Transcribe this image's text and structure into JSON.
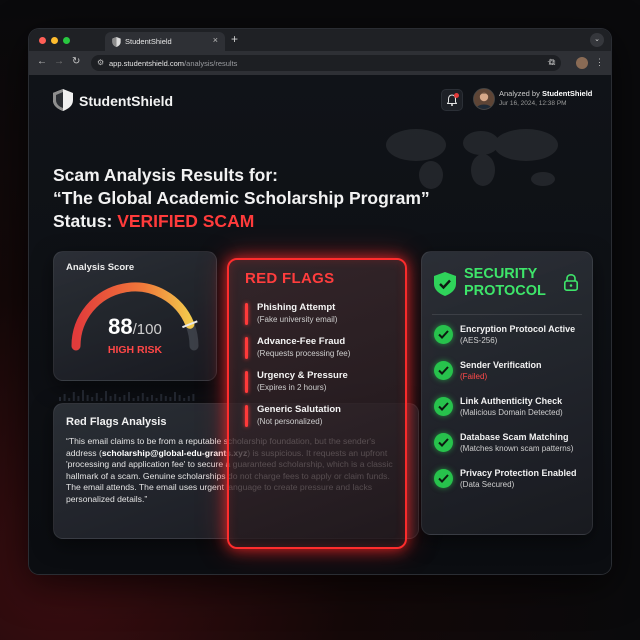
{
  "browser": {
    "tab_title": "StudentShield",
    "tab_close": "×",
    "new_tab": "+",
    "url_host": "app.studentshield.com",
    "url_path": "/analysis/results"
  },
  "header": {
    "brand": "StudentShield",
    "analyzed_prefix": "Analyzed by ",
    "analyzed_by": "StudentShield",
    "timestamp": "Jur 16, 2024, 12:38 PM"
  },
  "title": {
    "line1": "Scam Analysis Results for:",
    "line2": "“The Global Academic Scholarship Program”",
    "status_label": "Status: ",
    "status_value": "VERIFIED SCAM"
  },
  "score": {
    "title": "Analysis Score",
    "value": "88",
    "max": "/100",
    "value_fraction": 0.88,
    "risk": "HIGH RISK"
  },
  "red_flags": {
    "title": "RED FLAGS",
    "items": [
      {
        "name": "Phishing Attempt",
        "detail": "(Fake university email)"
      },
      {
        "name": "Advance-Fee Fraud",
        "detail": "(Requests processing fee)"
      },
      {
        "name": "Urgency & Pressure",
        "detail": "(Expires in 2 hours)"
      },
      {
        "name": "Generic Salutation",
        "detail": "(Not personalized)"
      }
    ]
  },
  "analysis": {
    "title": "Red Flags Analysis",
    "text_before": "“This email claims to be from a reputable scholarship foundation, but the sender's address (",
    "email": "scholarship@global-edu-grants.xyz",
    "text_after": ") is suspicious. It requests an upfront 'processing and application fee' to secure a guaranteed scholarship, which is a classic hallmark of a scam. Genuine scholarships do not charge fees to apply or claim funds. The email attends. The email uses urgent language to create pressure and lacks personalized details.”"
  },
  "security": {
    "title_line1": "SECURITY",
    "title_line2": "PROTOCOL",
    "items": [
      {
        "name": "Encryption Protocol Active",
        "detail": "(AES-256)",
        "status": "ok"
      },
      {
        "name": "Sender Verification",
        "detail": "(Failed)",
        "status": "failed"
      },
      {
        "name": "Link Authenticity Check",
        "detail": "(Malicious Domain Detected)",
        "status": "ok"
      },
      {
        "name": "Database Scam Matching",
        "detail": "(Matches known scam patterns)",
        "status": "ok"
      },
      {
        "name": "Privacy Protection Enabled",
        "detail": "(Data Secured)",
        "status": "ok"
      }
    ]
  },
  "colors": {
    "danger": "#ff3b3b",
    "success": "#3ee56a",
    "gauge_start": "#e23b3b",
    "gauge_end": "#f2c94c"
  }
}
